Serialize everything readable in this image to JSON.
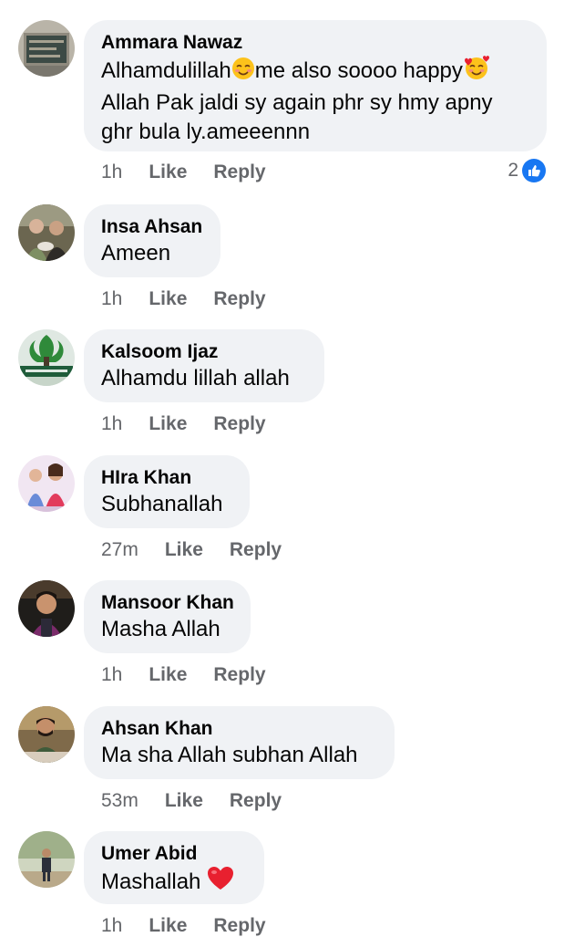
{
  "comments": [
    {
      "author": "Ammara Nawaz",
      "text_parts": [
        "Alhamdulillah",
        "me also soooo happy",
        "\nAllah Pak jaldi sy again phr sy hmy apny\nghr bula ly.ameeennn"
      ],
      "emoji": [
        "smiling-face-with-smiling-eyes",
        "smiling-face-with-hearts"
      ],
      "time": "1h",
      "like_label": "Like",
      "reply_label": "Reply",
      "reaction_count": "2",
      "reaction_icon": "thumbs-up-icon"
    },
    {
      "author": "Insa Ahsan",
      "text": "Ameen",
      "time": "1h",
      "like_label": "Like",
      "reply_label": "Reply"
    },
    {
      "author": "Kalsoom Ijaz",
      "text": "Alhamdu lillah allah",
      "time": "1h",
      "like_label": "Like",
      "reply_label": "Reply"
    },
    {
      "author": "HIra Khan",
      "text": "Subhanallah",
      "time": "27m",
      "like_label": "Like",
      "reply_label": "Reply"
    },
    {
      "author": "Mansoor Khan",
      "text": "Masha Allah",
      "time": "1h",
      "like_label": "Like",
      "reply_label": "Reply"
    },
    {
      "author": "Ahsan Khan",
      "text": "Ma sha Allah subhan Allah",
      "time": "53m",
      "like_label": "Like",
      "reply_label": "Reply"
    },
    {
      "author": "Umer Abid",
      "text": "Mashallah",
      "emoji": [
        "red-heart"
      ],
      "time": "1h",
      "like_label": "Like",
      "reply_label": "Reply"
    }
  ],
  "colors": {
    "bubble": "#f0f2f5",
    "meta": "#65676b",
    "like_blue": "#1877f2",
    "heart_red": "#e8202f"
  }
}
